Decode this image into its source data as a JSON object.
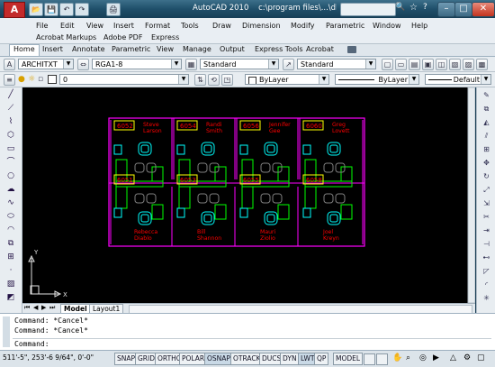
{
  "window": {
    "app_title": "AutoCAD 2010",
    "file_title": "c:\\program files\\...\\db_samp.dwg - Read Only",
    "search_glyph": "🔍",
    "star_glyph": "☆",
    "help_glyph": "?",
    "minimize_glyph": "–",
    "maximize_glyph": "□",
    "close_glyph": "✕"
  },
  "quick_access": [
    "📂",
    "💾",
    "↶",
    "↷",
    "🖨"
  ],
  "menu": {
    "row1": [
      "File",
      "Edit",
      "View",
      "Insert",
      "Format",
      "Tools",
      "Draw",
      "Dimension",
      "Modify",
      "Parametric",
      "Window",
      "Help"
    ],
    "row2": [
      "Acrobat Markups",
      "Adobe PDF",
      "Express"
    ]
  },
  "ribbon_tabs": [
    "Home",
    "Insert",
    "Annotate",
    "Parametric",
    "View",
    "Manage",
    "Output",
    "Express Tools",
    "Acrobat"
  ],
  "ribbon_active": "Home",
  "styles_toolbar": {
    "text_style": "ARCHITXT",
    "dim_style": "RGA1-8",
    "table_style": "Standard",
    "multileader_style": "Standard"
  },
  "layers_toolbar": {
    "layer_value": "0",
    "color": "ByLayer",
    "linetype": "ByLayer",
    "lineweight": "Default"
  },
  "offices": [
    {
      "number": "6052",
      "name1": "Steve",
      "name2": "Larson"
    },
    {
      "number": "6054",
      "name1": "Randi",
      "name2": "Smith"
    },
    {
      "number": "6056",
      "name1": "Jennifer",
      "name2": "Gee"
    },
    {
      "number": "6060",
      "name1": "Greg",
      "name2": "Lovett"
    },
    {
      "number": "6051",
      "name1": "Rebecca",
      "name2": "Diablo"
    },
    {
      "number": "6053",
      "name1": "Bill",
      "name2": "Shannon"
    },
    {
      "number": "6055",
      "name1": "Mauri",
      "name2": "Ziolio"
    },
    {
      "number": "6058",
      "name1": "Joel",
      "name2": "Kreyn"
    }
  ],
  "ucs": {
    "x_label": "X",
    "y_label": "Y"
  },
  "layout_tabs": [
    "Model",
    "Layout1"
  ],
  "layout_nav": [
    "⏮",
    "◀",
    "▶",
    "⏭"
  ],
  "command": {
    "line1": "Command: *Cancel*",
    "line2": "Command: *Cancel*",
    "prompt": "Command:"
  },
  "status": {
    "coordinates": "511'-5\", 253'-6 9/64\", 0'-0\"",
    "toggles": [
      "SNAP",
      "GRID",
      "ORTHO",
      "POLAR",
      "OSNAP",
      "OTRACK",
      "DUCS",
      "DYN",
      "LWT",
      "QP"
    ],
    "active": [
      "OSNAP",
      "LWT"
    ],
    "model": "MODEL"
  },
  "colors": {
    "canvas": "#000000",
    "wall": "#ff00ff",
    "desk": "#00ff00",
    "chair": "#00ffff",
    "label": "#ff0000",
    "tag": "#ffff00"
  }
}
